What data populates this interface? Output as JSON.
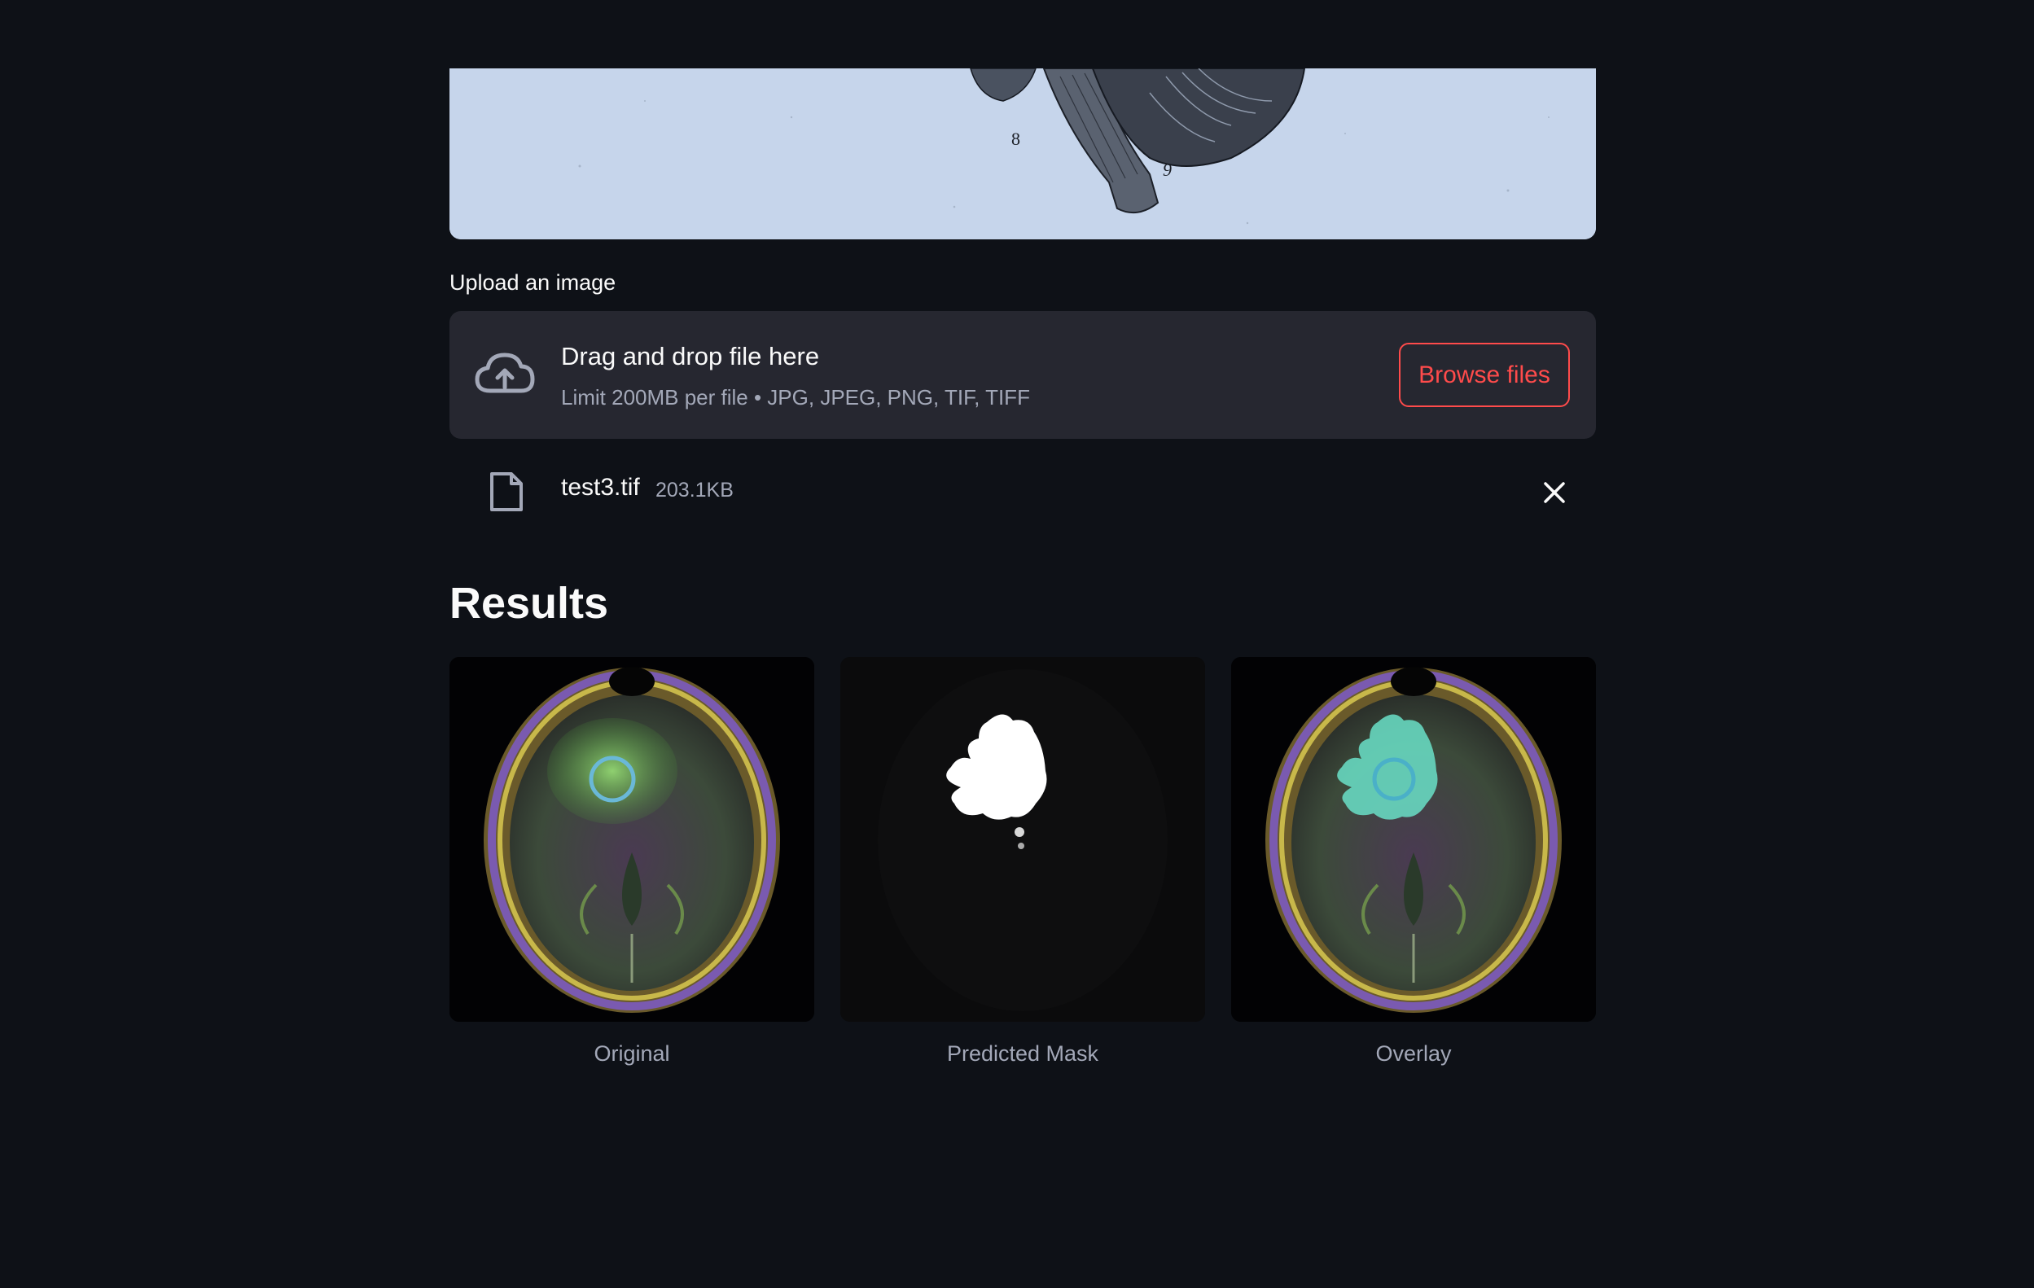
{
  "banner": {
    "illustration": "brain-anatomy-engraving",
    "label_8": "8",
    "label_9": "9"
  },
  "uploader": {
    "label": "Upload an image",
    "dropzone_title": "Drag and drop file here",
    "dropzone_limits": "Limit 200MB per file • JPG, JPEG, PNG, TIF, TIFF",
    "browse_label": "Browse files",
    "icon": "cloud-upload-icon"
  },
  "uploaded_file": {
    "name": "test3.tif",
    "size": "203.1KB",
    "icon": "file-icon",
    "remove_icon": "close-icon"
  },
  "results": {
    "title": "Results",
    "images": [
      {
        "caption": "Original"
      },
      {
        "caption": "Predicted Mask"
      },
      {
        "caption": "Overlay"
      }
    ]
  },
  "colors": {
    "background": "#0e1117",
    "dropzone": "#262730",
    "accent": "#ff4b4b",
    "muted_text": "#a3a8b8"
  }
}
